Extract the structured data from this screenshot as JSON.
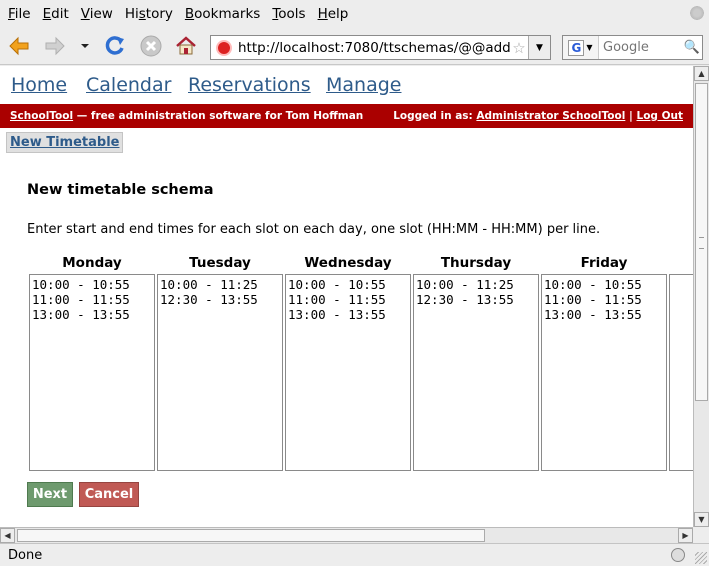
{
  "menu": [
    {
      "label": "File",
      "key": "F",
      "rest": "ile"
    },
    {
      "label": "Edit",
      "key": "E",
      "rest": "dit"
    },
    {
      "label": "View",
      "key": "V",
      "rest": "iew"
    },
    {
      "label": "History",
      "key": "",
      "rest": "History",
      "ulIndex": 1
    },
    {
      "label": "Bookmarks",
      "key": "B",
      "rest": "ookmarks"
    },
    {
      "label": "Tools",
      "key": "T",
      "rest": "ools"
    },
    {
      "label": "Help",
      "key": "H",
      "rest": "elp"
    }
  ],
  "browser": {
    "url": "http://localhost:7080/ttschemas/@@add",
    "search_placeholder": "Google",
    "status": "Done"
  },
  "site_nav": {
    "home": "Home",
    "calendar": "Calendar",
    "reservations": "Reservations",
    "manage": "Manage"
  },
  "banner": {
    "brand": "SchoolTool",
    "tagline": " — free administration software for Tom Hoffman",
    "logged_in_label": "Logged in as: ",
    "user": "Administrator SchoolTool",
    "separator": " | ",
    "logout": "Log Out"
  },
  "tab": {
    "label": "New Timetable"
  },
  "page": {
    "title": "New timetable schema",
    "instructions": "Enter start and end times for each slot on each day, one slot (HH:MM - HH:MM) per line."
  },
  "days": [
    {
      "name": "Monday",
      "slots": "10:00 - 10:55\n11:00 - 11:55\n13:00 - 13:55"
    },
    {
      "name": "Tuesday",
      "slots": "10:00 - 11:25\n12:30 - 13:55"
    },
    {
      "name": "Wednesday",
      "slots": "10:00 - 10:55\n11:00 - 11:55\n13:00 - 13:55"
    },
    {
      "name": "Thursday",
      "slots": "10:00 - 11:25\n12:30 - 13:55"
    },
    {
      "name": "Friday",
      "slots": "10:00 - 10:55\n11:00 - 11:55\n13:00 - 13:55"
    },
    {
      "name": "",
      "slots": ""
    }
  ],
  "buttons": {
    "next": "Next",
    "cancel": "Cancel"
  },
  "colors": {
    "accent_red": "#aa0000",
    "link_blue": "#2e5b8a",
    "next_green": "#6e9a6e",
    "cancel_red": "#c05a55"
  },
  "icons": {
    "back": "back-arrow-icon",
    "forward": "forward-arrow-icon",
    "reload": "reload-icon",
    "stop": "stop-icon",
    "home": "home-icon",
    "bookmark_star": "star-icon",
    "search": "magnifier-icon"
  }
}
